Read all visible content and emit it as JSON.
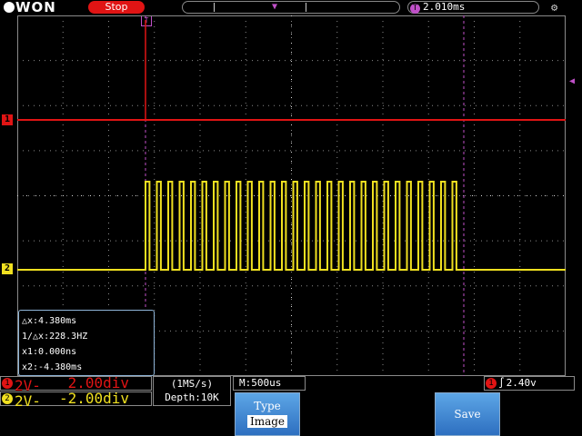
{
  "brand": {
    "logo_text": "WON"
  },
  "topbar": {
    "run_state": "Stop",
    "time_offset": "2.010ms",
    "trigger_marker_letter": "T"
  },
  "channels": {
    "ch1": {
      "marker": "1",
      "label": "2V-",
      "scale": "2.00div",
      "color": "#e01414"
    },
    "ch2": {
      "marker": "2",
      "label": "2V-",
      "scale": "-2.00div",
      "color": "#f0e020"
    }
  },
  "measurements": {
    "delta_x": "△x:4.380ms",
    "inv_delta_x": "1/△x:228.3HZ",
    "x1": "x1:0.000ns",
    "x2": "x2:-4.380ms"
  },
  "acquisition": {
    "sample_rate": "(1MS/s)",
    "depth": "Depth:10K",
    "timebase": "M:500us"
  },
  "trigger": {
    "source": "1",
    "level": "2.40v"
  },
  "menu": {
    "type_caption": "Type",
    "type_option": "Image",
    "save_label": "Save"
  },
  "waveform": {
    "pulse_count": 28,
    "colors": {
      "ch1": "#e01414",
      "ch2": "#f0e020",
      "cursor": "#c050c8",
      "grid": "#8a8a8a"
    }
  }
}
